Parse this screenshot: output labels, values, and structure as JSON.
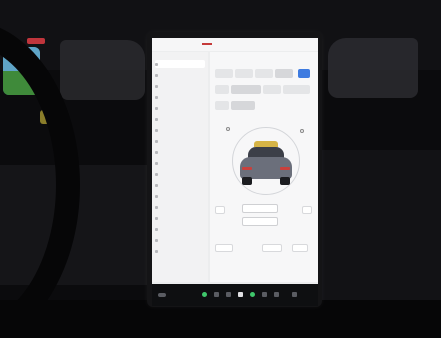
{
  "screen": {
    "status_bar": {
      "left_text": "",
      "right_text": ""
    },
    "menu": {
      "items": [
        {
          "label": "",
          "active": true
        },
        {
          "label": "",
          "active": false
        },
        {
          "label": "",
          "active": false
        },
        {
          "label": "",
          "active": false
        },
        {
          "label": "",
          "active": false
        },
        {
          "label": "",
          "active": false
        },
        {
          "label": "",
          "active": false
        },
        {
          "label": "",
          "active": false
        },
        {
          "label": "",
          "active": false
        },
        {
          "label": "",
          "active": false
        },
        {
          "label": "",
          "active": false
        },
        {
          "label": "",
          "active": false
        },
        {
          "label": "",
          "active": false
        },
        {
          "label": "",
          "active": false
        },
        {
          "label": "",
          "active": false
        },
        {
          "label": "",
          "active": false
        },
        {
          "label": "",
          "active": false
        },
        {
          "label": "",
          "active": false
        }
      ]
    },
    "controls": {
      "section_title_1": "",
      "section_title_2": "",
      "buttons": []
    },
    "taskbar": {
      "temperature": "",
      "colors": {
        "accent_blue": "#3e7be0",
        "green_dot": "#3fc66b",
        "red_light": "#c9403c"
      }
    }
  },
  "scene": {
    "colors": {
      "bezel": "#141416",
      "screen": "#ecedee",
      "cabin": "#0b0b0d"
    }
  }
}
